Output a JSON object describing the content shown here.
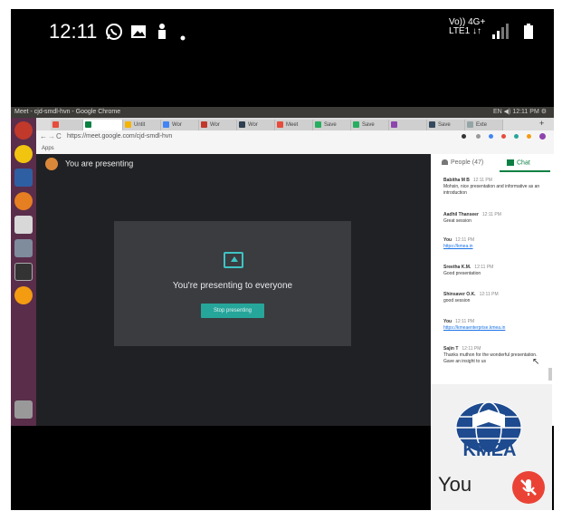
{
  "status_bar": {
    "time": "12:11",
    "network_lines": [
      "Vo)) 4G+",
      "LTE1 ↓↑"
    ],
    "icons": [
      "whatsapp-icon",
      "gallery-icon",
      "person-icon",
      "dot-icon",
      "signal-icon",
      "battery-icon"
    ]
  },
  "desktop": {
    "window_title": "Meet - cjd-smdl-hvn - Google Chrome",
    "top_right": "EN  ◀)  12:11 PM  ⚙"
  },
  "chrome": {
    "tabs": [
      "",
      "",
      "",
      "Untit",
      "Wor",
      "Wor",
      "Wor",
      "Meet",
      "Save",
      "Save",
      "",
      "Save",
      "Exte"
    ],
    "url": "https://meet.google.com/cjd-smdl-hvn",
    "bookmarks_label": "Apps"
  },
  "meet": {
    "presenting_header": "You are presenting",
    "card_text": "You're presenting to everyone",
    "stop_button": "Stop presenting"
  },
  "side_panel": {
    "people_tab": "People (47)",
    "chat_tab": "Chat",
    "messages": [
      {
        "sender": "Babitha M B",
        "time": "12:11 PM",
        "text": "Mohsin, nice presentation and informative as an introduction",
        "link": ""
      },
      {
        "sender": "Aadhil Thanseer",
        "time": "12:11 PM",
        "text": "Great session",
        "link": ""
      },
      {
        "sender": "You",
        "time": "12:11 PM",
        "text": "",
        "link": "https://kmea.in"
      },
      {
        "sender": "Sreetha K.M.",
        "time": "12:11 PM",
        "text": "Good presentation",
        "link": ""
      },
      {
        "sender": "Shinsaver O.K.",
        "time": "12:11 PM",
        "text": "good session",
        "link": ""
      },
      {
        "sender": "You",
        "time": "12:11 PM",
        "text": "",
        "link": "https://kmeaenterprise.kmea.in"
      },
      {
        "sender": "Sajin T",
        "time": "12:11 PM",
        "text": "Thanks muthon for the wonderful presentation. Gave an insight to us",
        "link": ""
      }
    ]
  },
  "self_view": {
    "label": "You",
    "logo_text": "KMEA"
  },
  "colors": {
    "meet_bg": "#202124",
    "accent_teal": "#26a69a",
    "chat_green": "#0b8043",
    "mute_red": "#ea4335",
    "launcher": "#5a2d4a"
  }
}
